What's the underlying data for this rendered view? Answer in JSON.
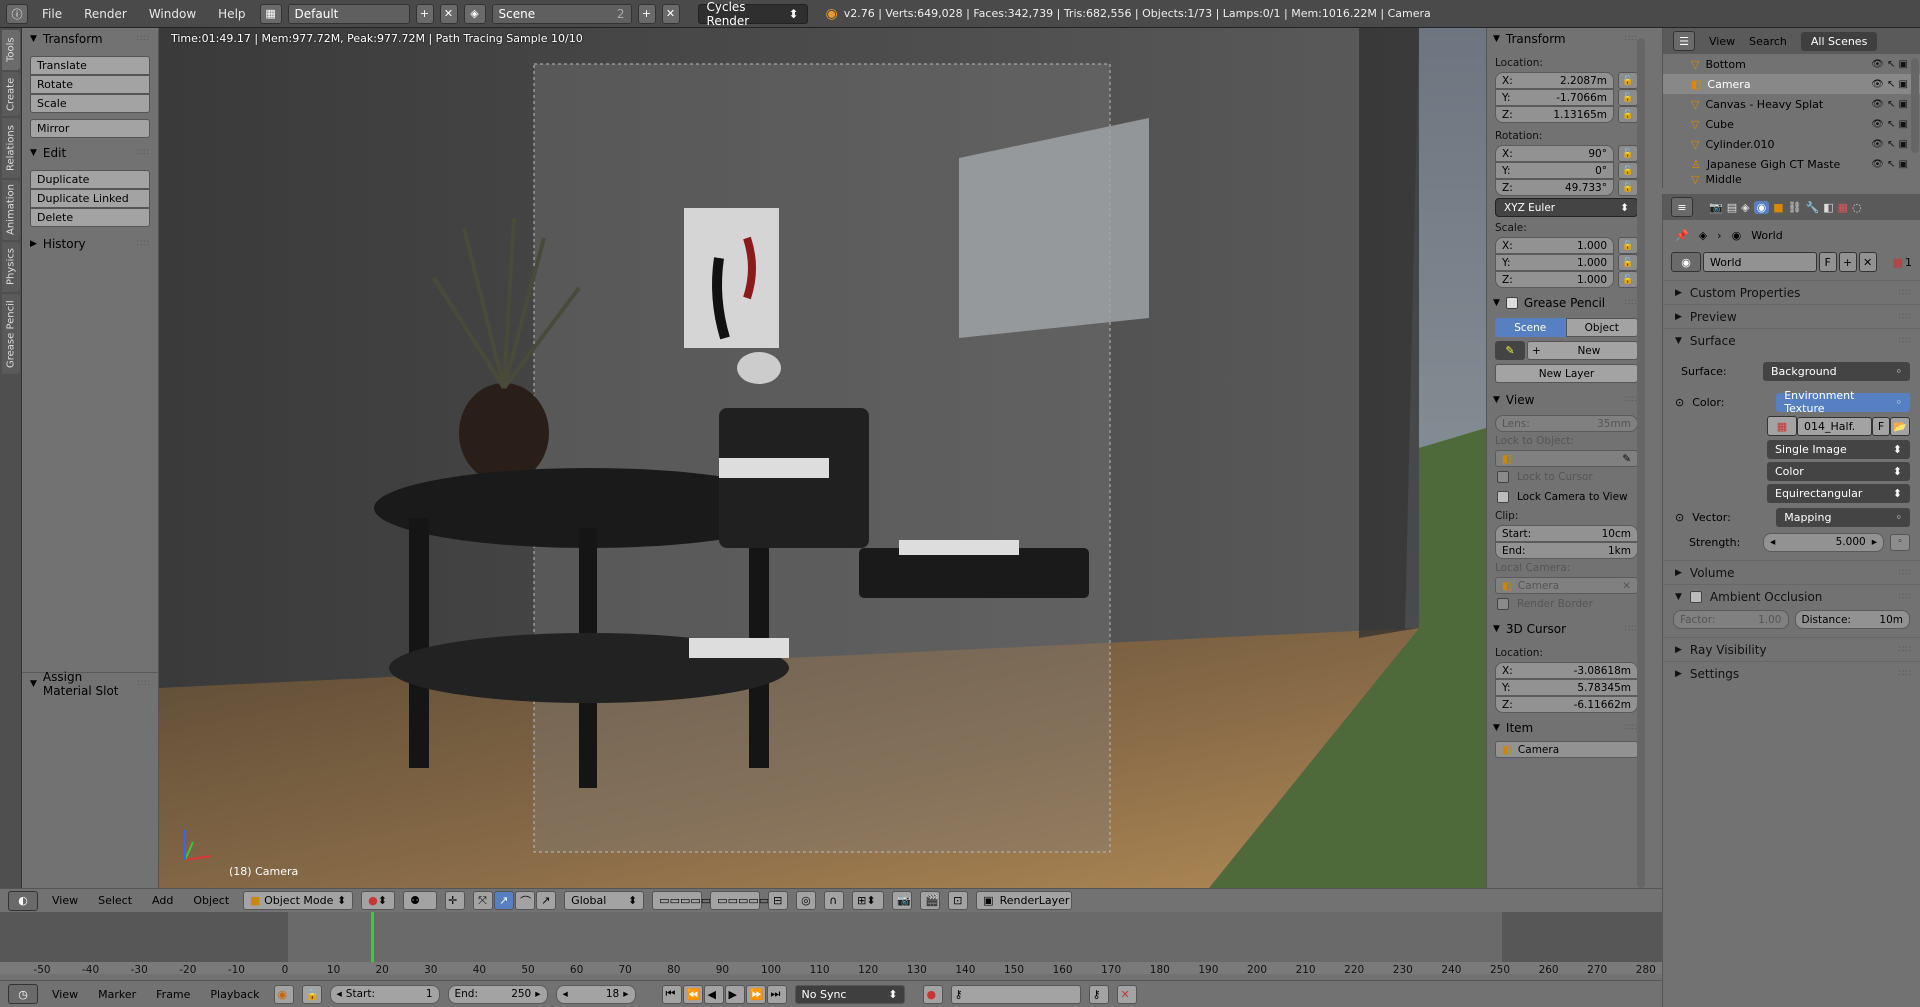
{
  "topbar": {
    "menus": [
      "File",
      "Render",
      "Window",
      "Help"
    ],
    "layout": "Default",
    "scene": "Scene",
    "scene_users": "2",
    "engine": "Cycles Render",
    "stats": "v2.76 | Verts:649,028 | Faces:342,739 | Tris:682,556 | Objects:1/73 | Lamps:0/1 | Mem:1016.22M | Camera"
  },
  "left_tabs": [
    "Tools",
    "Create",
    "Relations",
    "Animation",
    "Physics",
    "Grease Pencil"
  ],
  "toolshelf": {
    "transform_title": "Transform",
    "transform_buttons": [
      "Translate",
      "Rotate",
      "Scale"
    ],
    "mirror": "Mirror",
    "edit_title": "Edit",
    "edit_buttons": [
      "Duplicate",
      "Duplicate Linked",
      "Delete"
    ],
    "history_title": "History",
    "operator_title": "Assign Material Slot"
  },
  "viewport": {
    "info": "Time:01:49.17 | Mem:977.72M, Peak:977.72M | Path Tracing Sample 10/10",
    "camera_label": "(18) Camera"
  },
  "npanel": {
    "transform_title": "Transform",
    "location_label": "Location:",
    "location": {
      "x": "2.2087m",
      "y": "-1.7066m",
      "z": "1.13165m"
    },
    "rotation_label": "Rotation:",
    "rotation": {
      "x": "90°",
      "y": "0°",
      "z": "49.733°"
    },
    "rotation_mode": "XYZ Euler",
    "scale_label": "Scale:",
    "scale": {
      "x": "1.000",
      "y": "1.000",
      "z": "1.000"
    },
    "grease_title": "Grease Pencil",
    "grease_scene": "Scene",
    "grease_object": "Object",
    "grease_new": "New",
    "grease_new_layer": "New Layer",
    "view_title": "View",
    "lens_label": "Lens:",
    "lens_value": "35mm",
    "lock_object_label": "Lock to Object:",
    "lock_cursor": "Lock to Cursor",
    "lock_camera": "Lock Camera to View",
    "clip_label": "Clip:",
    "clip_start_label": "Start:",
    "clip_start": "10cm",
    "clip_end_label": "End:",
    "clip_end": "1km",
    "local_camera_label": "Local Camera:",
    "local_camera": "Camera",
    "render_border": "Render Border",
    "cursor_title": "3D Cursor",
    "cursor_location_label": "Location:",
    "cursor": {
      "x": "-3.08618m",
      "y": "5.78345m",
      "z": "-6.11662m"
    },
    "item_title": "Item",
    "item_name": "Camera",
    "axis_x": "X:",
    "axis_y": "Y:",
    "axis_z": "Z:"
  },
  "outliner": {
    "menus": [
      "View",
      "Search"
    ],
    "filter": "All Scenes",
    "items": [
      "Bottom",
      "Camera",
      "Canvas - Heavy Splat",
      "Cube",
      "Cylinder.010",
      "Japanese Gigh CT Maste",
      "Middle"
    ]
  },
  "properties": {
    "breadcrumb": "World",
    "world_name": "World",
    "fake_user": "F",
    "users": "1",
    "panels": [
      "Custom Properties",
      "Preview",
      "Surface"
    ],
    "surface_label": "Surface:",
    "surface_value": "Background",
    "color_label": "Color:",
    "color_value": "Environment Texture",
    "image_name": "014_Half.",
    "image_fake": "F",
    "image_source": "Single Image",
    "color_space": "Color",
    "projection": "Equirectangular",
    "vector_label": "Vector:",
    "vector_value": "Mapping",
    "strength_label": "Strength:",
    "strength_value": "5.000",
    "volume": "Volume",
    "ao": "Ambient Occlusion",
    "ao_factor_label": "Factor:",
    "ao_factor": "1.00",
    "ao_distance_label": "Distance:",
    "ao_distance": "10m",
    "ray_visibility": "Ray Visibility",
    "settings": "Settings"
  },
  "vpheader": {
    "menus": [
      "View",
      "Select",
      "Add",
      "Object"
    ],
    "mode": "Object Mode",
    "orientation": "Global",
    "render_layer": "RenderLayer"
  },
  "timeline": {
    "ticks": [
      "-50",
      "-40",
      "-30",
      "-20",
      "-10",
      "0",
      "10",
      "20",
      "30",
      "40",
      "50",
      "60",
      "70",
      "80",
      "90",
      "100",
      "110",
      "120",
      "130",
      "140",
      "150",
      "160",
      "170",
      "180",
      "190",
      "200",
      "210",
      "220",
      "230",
      "240",
      "250",
      "260",
      "270",
      "280"
    ],
    "current_frame": 18
  },
  "tlfooter": {
    "menus": [
      "View",
      "Marker",
      "Frame",
      "Playback"
    ],
    "start_label": "Start:",
    "start": "1",
    "end_label": "End:",
    "end": "250",
    "current": "18",
    "sync": "No Sync"
  }
}
